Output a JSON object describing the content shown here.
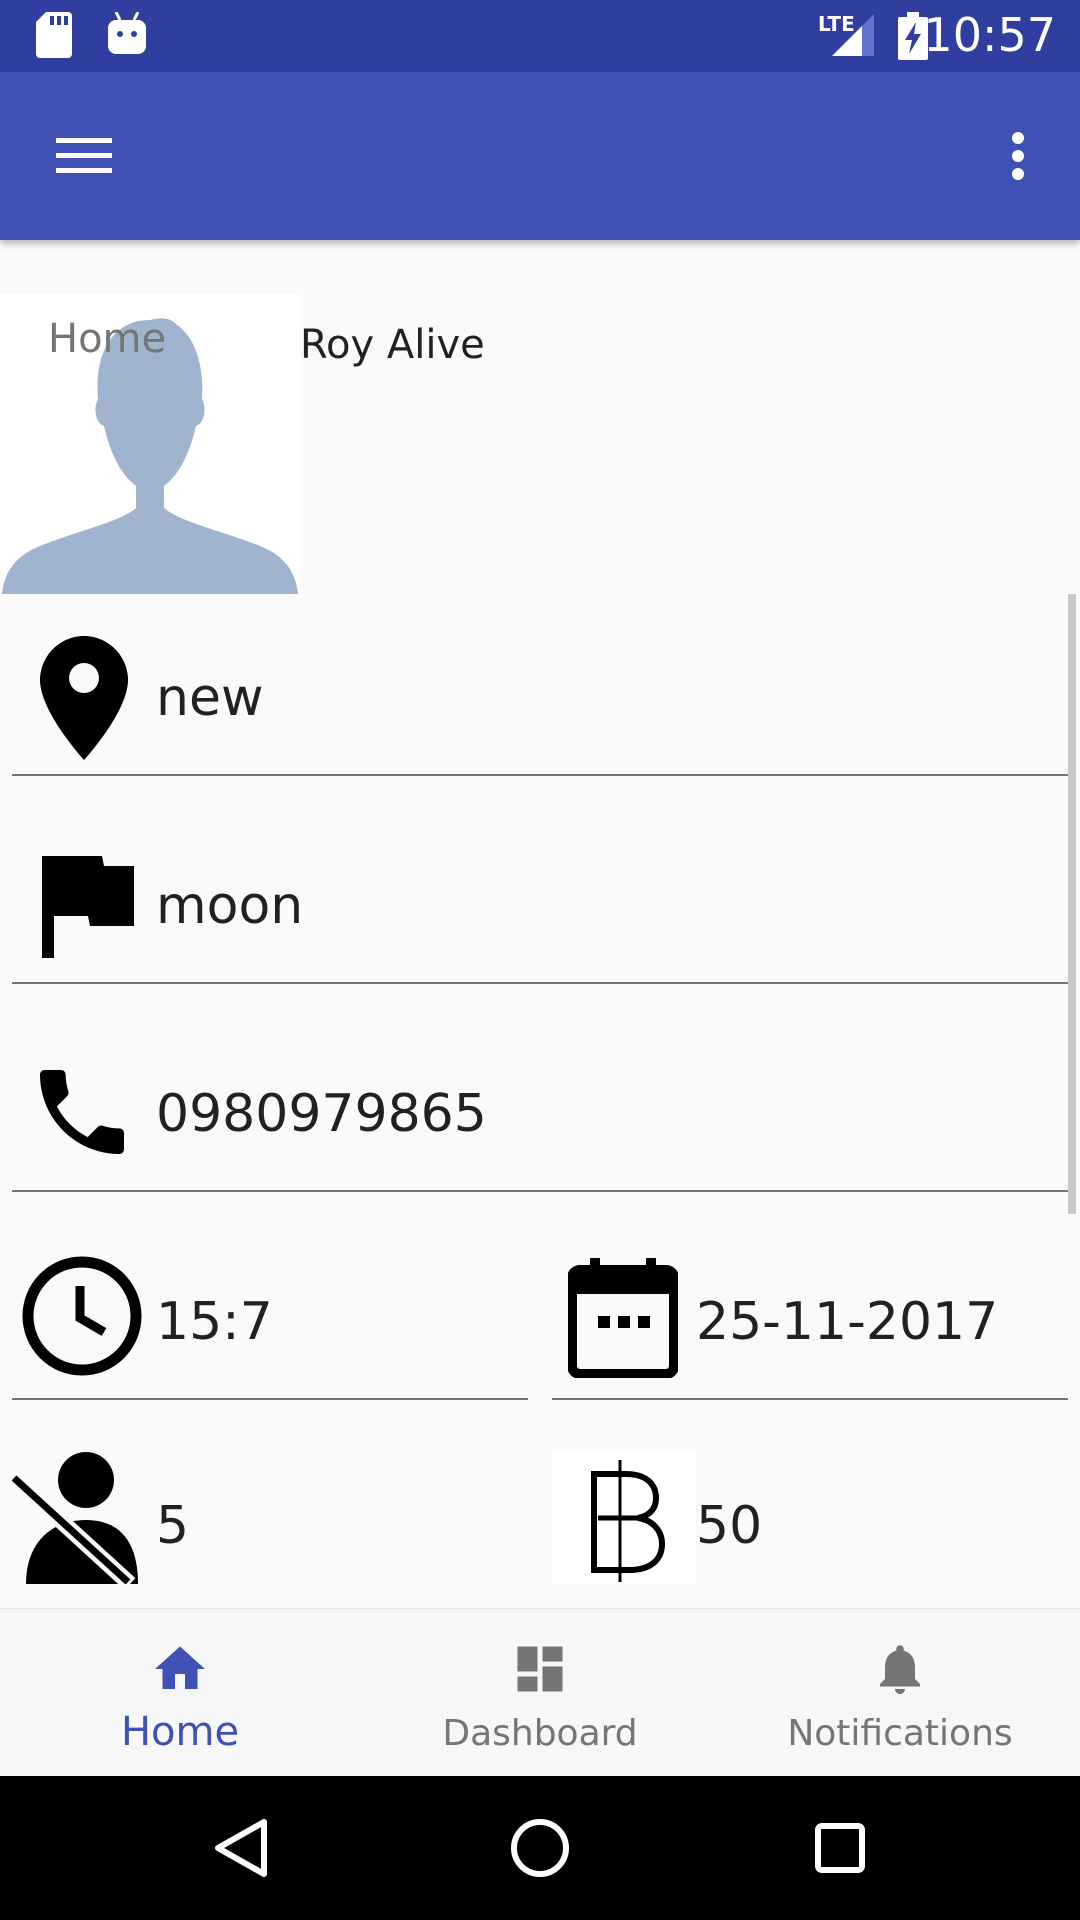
{
  "status_bar": {
    "time": "10:57",
    "network": "LTE",
    "icons": [
      "sd-card-icon",
      "android-debug-icon",
      "lte-signal-icon",
      "battery-charging-icon"
    ]
  },
  "app_bar": {
    "background": "#3f51b5",
    "menu_icon": "hamburger-menu-icon",
    "overflow_icon": "more-vert-icon"
  },
  "profile": {
    "page_label": "Home",
    "name": "Roy Alive",
    "avatar_icon": "person-silhouette-icon"
  },
  "fields": {
    "location": {
      "icon": "location-pin-icon",
      "value": "new"
    },
    "flag": {
      "icon": "flag-icon",
      "value": "moon"
    },
    "phone": {
      "icon": "phone-icon",
      "value": "0980979865"
    },
    "time": {
      "icon": "clock-icon",
      "value": "15:7"
    },
    "date": {
      "icon": "calendar-icon",
      "value": "25-11-2017"
    },
    "seats": {
      "icon": "seat-icon",
      "value": "5"
    },
    "price": {
      "icon": "baht-icon",
      "value": "50"
    }
  },
  "bottom_nav": {
    "accent": "#3f51b5",
    "items": [
      {
        "label": "Home",
        "icon": "home-icon",
        "active": true
      },
      {
        "label": "Dashboard",
        "icon": "dashboard-icon",
        "active": false
      },
      {
        "label": "Notifications",
        "icon": "bell-icon",
        "active": false
      }
    ]
  },
  "system_nav": {
    "icons": [
      "back-icon",
      "home-circle-icon",
      "recents-icon"
    ]
  }
}
